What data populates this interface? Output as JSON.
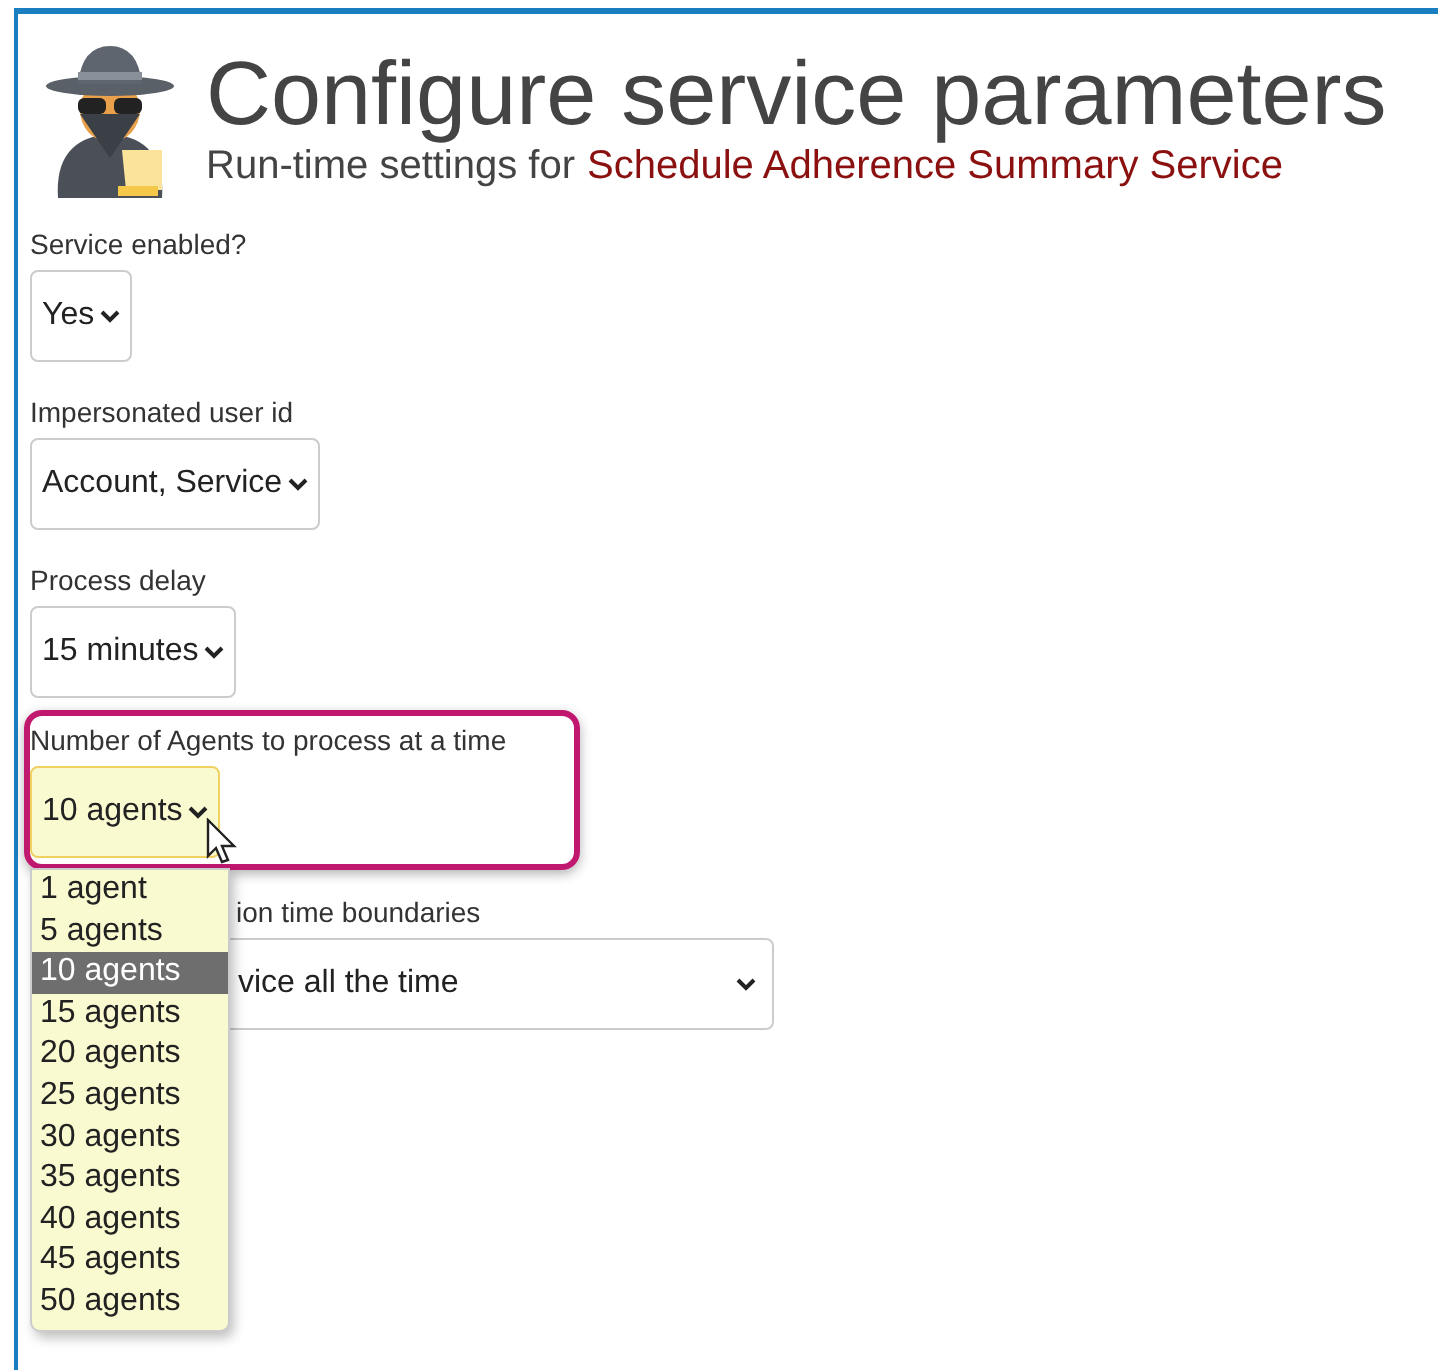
{
  "header": {
    "title": "Configure service parameters",
    "subtitle": "Run-time settings for",
    "service_name": "Schedule Adherence Summary Service"
  },
  "fields": [
    {
      "label": "Service enabled?",
      "value": "Yes",
      "highlighted": false,
      "open": false
    },
    {
      "label": "Impersonated user id",
      "value": "Account, Service",
      "highlighted": false,
      "open": false
    },
    {
      "label": "Process delay",
      "value": "15 minutes",
      "highlighted": false,
      "open": false
    },
    {
      "label": "Number of Agents to process at a time",
      "value": "10 agents",
      "highlighted": true,
      "open": true
    },
    {
      "label": "ion time boundaries",
      "value": "vice all the time",
      "highlighted": false,
      "open": false
    }
  ],
  "dropdown": {
    "options": [
      {
        "label": "1 agent",
        "selected": false
      },
      {
        "label": "5 agents",
        "selected": false
      },
      {
        "label": "10 agents",
        "selected": true
      },
      {
        "label": "15 agents",
        "selected": false
      },
      {
        "label": "20 agents",
        "selected": false
      },
      {
        "label": "25 agents",
        "selected": false
      },
      {
        "label": "30 agents",
        "selected": false
      },
      {
        "label": "35 agents",
        "selected": false
      },
      {
        "label": "40 agents",
        "selected": false
      },
      {
        "label": "45 agents",
        "selected": false
      },
      {
        "label": "50 agents",
        "selected": false
      }
    ]
  }
}
